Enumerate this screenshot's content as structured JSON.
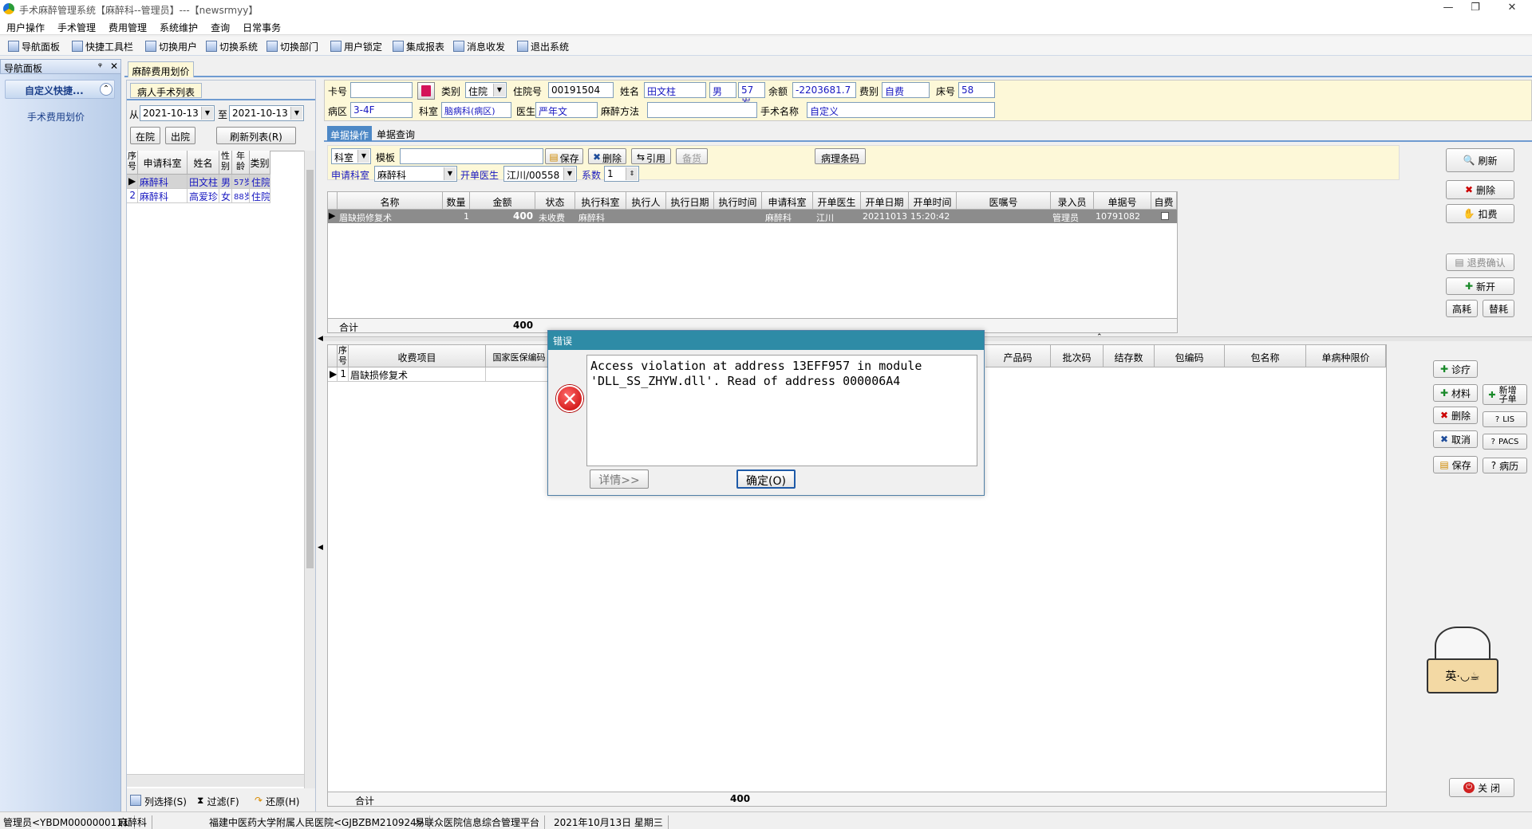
{
  "window": {
    "title": "手术麻醉管理系统【麻醉科--管理员】---【newsrmyy】",
    "min": "—",
    "max": "❐",
    "close": "✕"
  },
  "menu": [
    "用户操作",
    "手术管理",
    "费用管理",
    "系统维护",
    "查询",
    "日常事务"
  ],
  "toolbar": [
    "导航面板",
    "快捷工具栏",
    "切换用户",
    "切换系统",
    "切换部门",
    "用户锁定",
    "集成报表",
    "消息收发",
    "退出系统"
  ],
  "nav": {
    "header": "导航面板",
    "pin": "ᵠ",
    "close": "✕",
    "group": "自定义快捷...",
    "collapse": "⌃",
    "item": "手术费用划价"
  },
  "doc_tab": "麻醉费用划价",
  "left": {
    "tab": "病人手术列表",
    "from_label": "从",
    "from_date": "2021-10-13",
    "to_label": "至",
    "to_date": "2021-10-13",
    "btn_in": "在院",
    "btn_out": "出院",
    "btn_refresh": "刷新列表(R)",
    "columns": [
      "序号",
      "申请科室",
      "姓名",
      "性别",
      "年龄",
      "类别"
    ],
    "rows": [
      [
        "1",
        "麻醉科",
        "田文柱",
        "男",
        "57岁",
        "住院"
      ],
      [
        "2",
        "麻醉科",
        "高爱珍",
        "女",
        "88岁",
        "住院"
      ]
    ],
    "bottom": [
      "列选择(S)",
      "过滤(F)",
      "还原(H)"
    ]
  },
  "patient": {
    "card_label": "卡号",
    "card_value": "",
    "type_label": "类别",
    "type_value": "住院",
    "inpno_label": "住院号",
    "inpno_value": "00191504",
    "name_label": "姓名",
    "name_value": "田文柱",
    "sex_value": "男",
    "age_value": "57岁",
    "balance_label": "余额",
    "balance_value": "-2203681.7",
    "feetype_label": "费别",
    "feetype_value": "自费",
    "bed_label": "床号",
    "bed_value": "58",
    "ward_label": "病区",
    "ward_value": "3-4F",
    "dept_label": "科室",
    "dept_value": "脑病科(病区)",
    "doctor_label": "医生",
    "doctor_value": "严年文",
    "anes_label": "麻醉方法",
    "anes_value": "",
    "op_label": "手术名称",
    "op_value": "自定义"
  },
  "tabs": [
    "单据操作",
    "单据查询"
  ],
  "ops": {
    "dept_select": "科室",
    "template_label": "模板",
    "save": "保存",
    "delete": "删除",
    "cite": "引用",
    "stock": "备货",
    "pathology": "病理条码",
    "apply_dept_label": "申请科室",
    "apply_dept_value": "麻醉科",
    "open_doctor_label": "开单医生",
    "open_doctor_value": "江川/00558",
    "coef_label": "系数",
    "coef_value": "1"
  },
  "upper_grid": {
    "columns": [
      "名称",
      "数量",
      "金额",
      "状态",
      "执行科室",
      "执行人",
      "执行日期",
      "执行时间",
      "申请科室",
      "开单医生",
      "开单日期",
      "开单时间",
      "医嘱号",
      "录入员",
      "单据号",
      "自费"
    ],
    "row": [
      "眉缺损修复术",
      "1",
      "400",
      "未收费",
      "麻醉科",
      "",
      "",
      "",
      "麻醉科",
      "江川",
      "20211013",
      "15:20:42",
      "",
      "管理员",
      "10791082",
      ""
    ],
    "total_label": "合计",
    "total_value": "400"
  },
  "lower_grid": {
    "columns": [
      "序号",
      "收费项目",
      "国家医保编码",
      "产品码",
      "批次码",
      "结存数",
      "包编码",
      "包名称",
      "单病种限价"
    ],
    "row": [
      "1",
      "眉缺损修复术"
    ],
    "total_label": "合计",
    "total_value": "400"
  },
  "right_buttons": {
    "refresh": "刷新",
    "delete": "删除",
    "deduct": "扣费",
    "refund": "退费确认",
    "new": "新开",
    "high": "高耗",
    "replace": "替耗",
    "treat": "诊疗",
    "material": "材料",
    "add_sub": "新增子单",
    "del2": "删除",
    "lis": "LIS",
    "cancel": "取消",
    "pacs": "PACS",
    "save2": "保存",
    "record": "病历",
    "close": "关 闭"
  },
  "dialog": {
    "title": "错误",
    "message": "Access violation at address 13EFF957 in module 'DLL_SS_ZHYW.dll'. Read of address 000006A4",
    "details": "详情>>",
    "ok": "确定(O)"
  },
  "mascot_text": "英·◡☕",
  "status": [
    "管理员<YBDM0000000111",
    "麻醉科",
    "福建中医药大学附属人民医院<GJBZBM210924>",
    "易联众医院信息综合管理平台",
    "2021年10月13日 星期三"
  ]
}
